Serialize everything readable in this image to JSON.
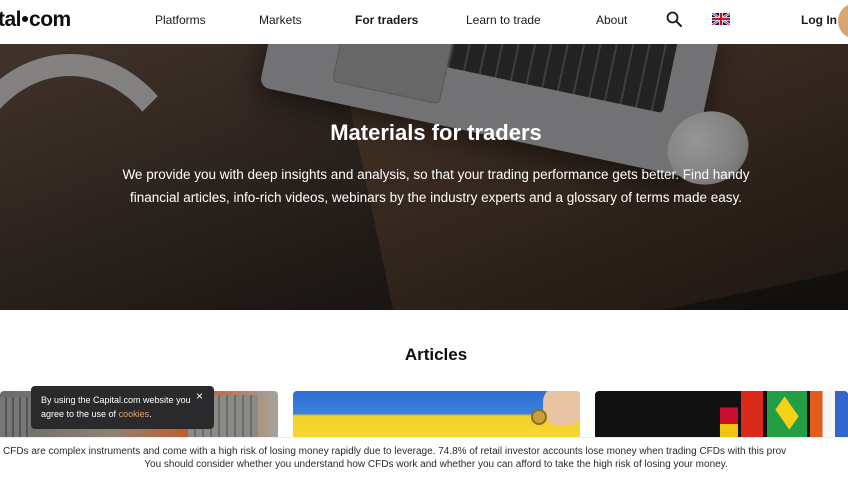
{
  "header": {
    "logo": "tal·com",
    "nav": [
      "Platforms",
      "Markets",
      "For traders",
      "Learn to trade",
      "About"
    ],
    "active_nav": "For traders",
    "login_label": "Log In",
    "icons": {
      "search": "search-icon",
      "language": "uk-flag-icon"
    }
  },
  "hero": {
    "title": "Materials for traders",
    "text": "We provide you with deep insights and analysis, so that your trading performance gets better. Find handy financial articles, info-rich videos, webinars by the industry experts and a glossary of terms made easy."
  },
  "articles": {
    "title": "Articles"
  },
  "cookie": {
    "text_before": "By using the Capital.com website you agree to the use of ",
    "link": "cookies",
    "text_after": ".",
    "close": "×"
  },
  "risk_warning": {
    "line1": "CFDs are complex instruments and come with a high risk of losing money rapidly due to leverage. 74.8% of retail investor accounts lose money when trading CFDs with this prov",
    "line2": "You should consider whether you understand how CFDs work and whether you can afford to take the high risk of losing your money."
  },
  "colors": {
    "accent": "#e0a36f",
    "text": "#0e0e0e",
    "cookie_bg": "#2a2a2c"
  }
}
